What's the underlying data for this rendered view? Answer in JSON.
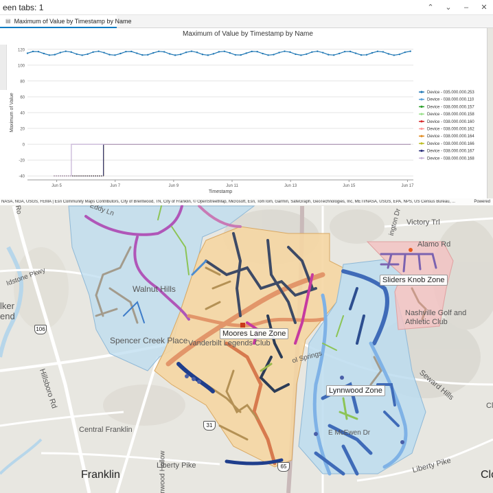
{
  "header": {
    "title": "een tabs: 1"
  },
  "tabs": [
    {
      "label": "Maximum of Value by Timestamp by Name"
    }
  ],
  "chart_data": {
    "type": "line",
    "title": "Maximum of Value by Timestamp by Name",
    "xlabel": "Timestamp",
    "ylabel": "Maximum of Value",
    "ylim": [
      -45,
      125
    ],
    "yticks": [
      -40,
      -20,
      0,
      20,
      40,
      60,
      80,
      100,
      120
    ],
    "x_range_days": [
      4,
      17.2
    ],
    "xticks": [
      {
        "day": 5,
        "label": "Jun 5"
      },
      {
        "day": 7,
        "label": "Jun 7"
      },
      {
        "day": 9,
        "label": "Jun 9"
      },
      {
        "day": 11,
        "label": "Jun 11"
      },
      {
        "day": 13,
        "label": "Jun 13"
      },
      {
        "day": 15,
        "label": "Jun 15"
      },
      {
        "day": 17,
        "label": "Jun 17"
      }
    ],
    "grid": true,
    "legend_position": "right",
    "series": [
      {
        "name": "Device - 035.000.000.253",
        "color": "#1f77b4",
        "pattern": "oscillate",
        "base": 115,
        "amp": 2.5,
        "start_day": 4.0,
        "end_day": 17.1,
        "drop_value": null
      },
      {
        "name": "Device - 038.000.000.110",
        "color": "#5aa0d8",
        "pattern": "flat",
        "base": 0,
        "start_day": 6.6,
        "end_day": 17.1,
        "drop_value": -40
      },
      {
        "name": "Device - 038.000.000.157",
        "color": "#2ca02c",
        "pattern": "flat",
        "base": 0,
        "start_day": 6.6,
        "end_day": 17.1,
        "drop_value": -40
      },
      {
        "name": "Device - 038.000.000.158",
        "color": "#98df8a",
        "pattern": "flat",
        "base": 0,
        "start_day": 6.6,
        "end_day": 17.1,
        "drop_value": -40
      },
      {
        "name": "Device - 038.000.000.160",
        "color": "#d62728",
        "pattern": "flat",
        "base": 0,
        "start_day": 6.6,
        "end_day": 17.1,
        "drop_value": -40
      },
      {
        "name": "Device - 038.000.000.162",
        "color": "#ff9896",
        "pattern": "flat",
        "base": 0,
        "start_day": 6.6,
        "end_day": 17.1,
        "drop_value": -40
      },
      {
        "name": "Device - 038.000.000.164",
        "color": "#e08a1e",
        "pattern": "flat",
        "base": 0,
        "start_day": 6.6,
        "end_day": 17.1,
        "drop_value": -40
      },
      {
        "name": "Device - 038.000.000.166",
        "color": "#bcbd22",
        "pattern": "flat",
        "base": 0,
        "start_day": 6.6,
        "end_day": 17.1,
        "drop_value": -40
      },
      {
        "name": "Device - 038.000.000.167",
        "color": "#2b2f7a",
        "pattern": "flat",
        "base": 0,
        "start_day": 6.6,
        "end_day": 17.1,
        "drop_value": -40
      },
      {
        "name": "Device - 038.000.000.168",
        "color": "#c5b0d5",
        "pattern": "flat",
        "base": 0,
        "start_day": 5.5,
        "end_day": 17.1,
        "drop_value": -40
      }
    ]
  },
  "attribution": {
    "credits": "NASA, NGA, USGS, FEMA | Esri Community Maps Contributors, City of Brentwood, TN, City of Franklin, © OpenStreetMap, Microsoft, Esri, TomTom, Garmin, SafeGraph, GeoTechnologies, Inc, METI/NASA, USGS, EPA, NPS, US Census Bureau, ...",
    "powered": "Powered"
  },
  "map": {
    "zones": [
      {
        "label": "Moores Lane Zone"
      },
      {
        "label": "Sliders Knob Zone"
      },
      {
        "label": "Lynnwood Zone"
      }
    ],
    "places": [
      {
        "label": "Walnut Hills"
      },
      {
        "label": "Spencer Creek Place"
      },
      {
        "label": "Vanderbilt Legends Club"
      },
      {
        "label": "Nashville Golf and Athletic Club"
      },
      {
        "label": "Central Franklin"
      },
      {
        "label": "Franklin"
      },
      {
        "label": "Victory Trl"
      },
      {
        "label": "Alamo Rd"
      },
      {
        "label": "Liberty Pike"
      },
      {
        "label": "Liberty Pike"
      },
      {
        "label": "Seward Hills"
      },
      {
        "label": "Hillsboro Rd"
      },
      {
        "label": "Eddy Ln"
      },
      {
        "label": "Lynnwood Hollow"
      },
      {
        "label": "Idstone Pkwy"
      },
      {
        "label": "lker end"
      },
      {
        "label": "E McEwen Dr"
      },
      {
        "label": "ol Springs"
      },
      {
        "label": "Cl"
      },
      {
        "label": "Clo"
      },
      {
        "label": "ington Dr"
      },
      {
        "label": "Ro"
      }
    ],
    "shields": [
      {
        "label": "106"
      },
      {
        "label": "31"
      },
      {
        "label": "65"
      }
    ]
  }
}
